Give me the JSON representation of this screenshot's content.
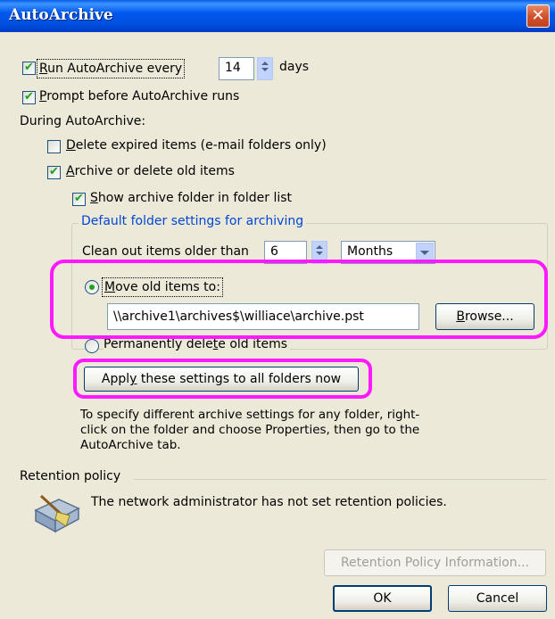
{
  "window": {
    "title": "AutoArchive",
    "close_glyph": "✕"
  },
  "run_autoarchive": {
    "label_pre": "",
    "label_u": "R",
    "label_post": "un AutoArchive every",
    "checked": true,
    "days_value": "14",
    "days_unit": "days"
  },
  "prompt_before": {
    "label_u": "P",
    "label_post": "rompt before AutoArchive runs",
    "checked": true
  },
  "during_heading": "During AutoArchive:",
  "delete_expired": {
    "label_u": "D",
    "label_post": "elete expired items (e-mail folders only)",
    "checked": false
  },
  "archive_delete_old": {
    "label_u": "A",
    "label_post": "rchive or delete old items",
    "checked": true
  },
  "show_archive_folder": {
    "label_u": "S",
    "label_post": "how archive folder in folder list",
    "checked": true
  },
  "default_settings": {
    "group_title": "Default folder settings for archiving",
    "clean_out_label": "Clean out items older than",
    "clean_out_value": "6",
    "clean_out_unit": "Months",
    "move_old": {
      "label_u": "M",
      "label_post": "ove old items to:",
      "selected": true
    },
    "archive_path": "\\\\archive1\\archives$\\williace\\archive.pst",
    "browse_label_u": "B",
    "browse_label_post": "rowse...",
    "perm_delete": {
      "label_pre": "Permanently dele",
      "label_u": "t",
      "label_post": "e old items",
      "selected": false
    }
  },
  "apply_button": {
    "label_pre": "Appl",
    "label_u": "y",
    "label_post": " these settings to all folders now"
  },
  "info_text": "To specify different archive settings for any folder, right-click on the folder and choose Properties, then go to the AutoArchive tab.",
  "retention": {
    "heading": "Retention policy",
    "message": "The network administrator has not set retention policies.",
    "icon": "broom-folder-icon",
    "info_button": "Retention Policy Information..."
  },
  "footer": {
    "ok_label": "OK",
    "cancel_label": "Cancel"
  },
  "colors": {
    "titlebar": "#0058ee",
    "dialog_bg": "#ece9d8",
    "highlight": "#ff19ff",
    "checkmark": "#21a121",
    "group_title": "#0046d5"
  }
}
